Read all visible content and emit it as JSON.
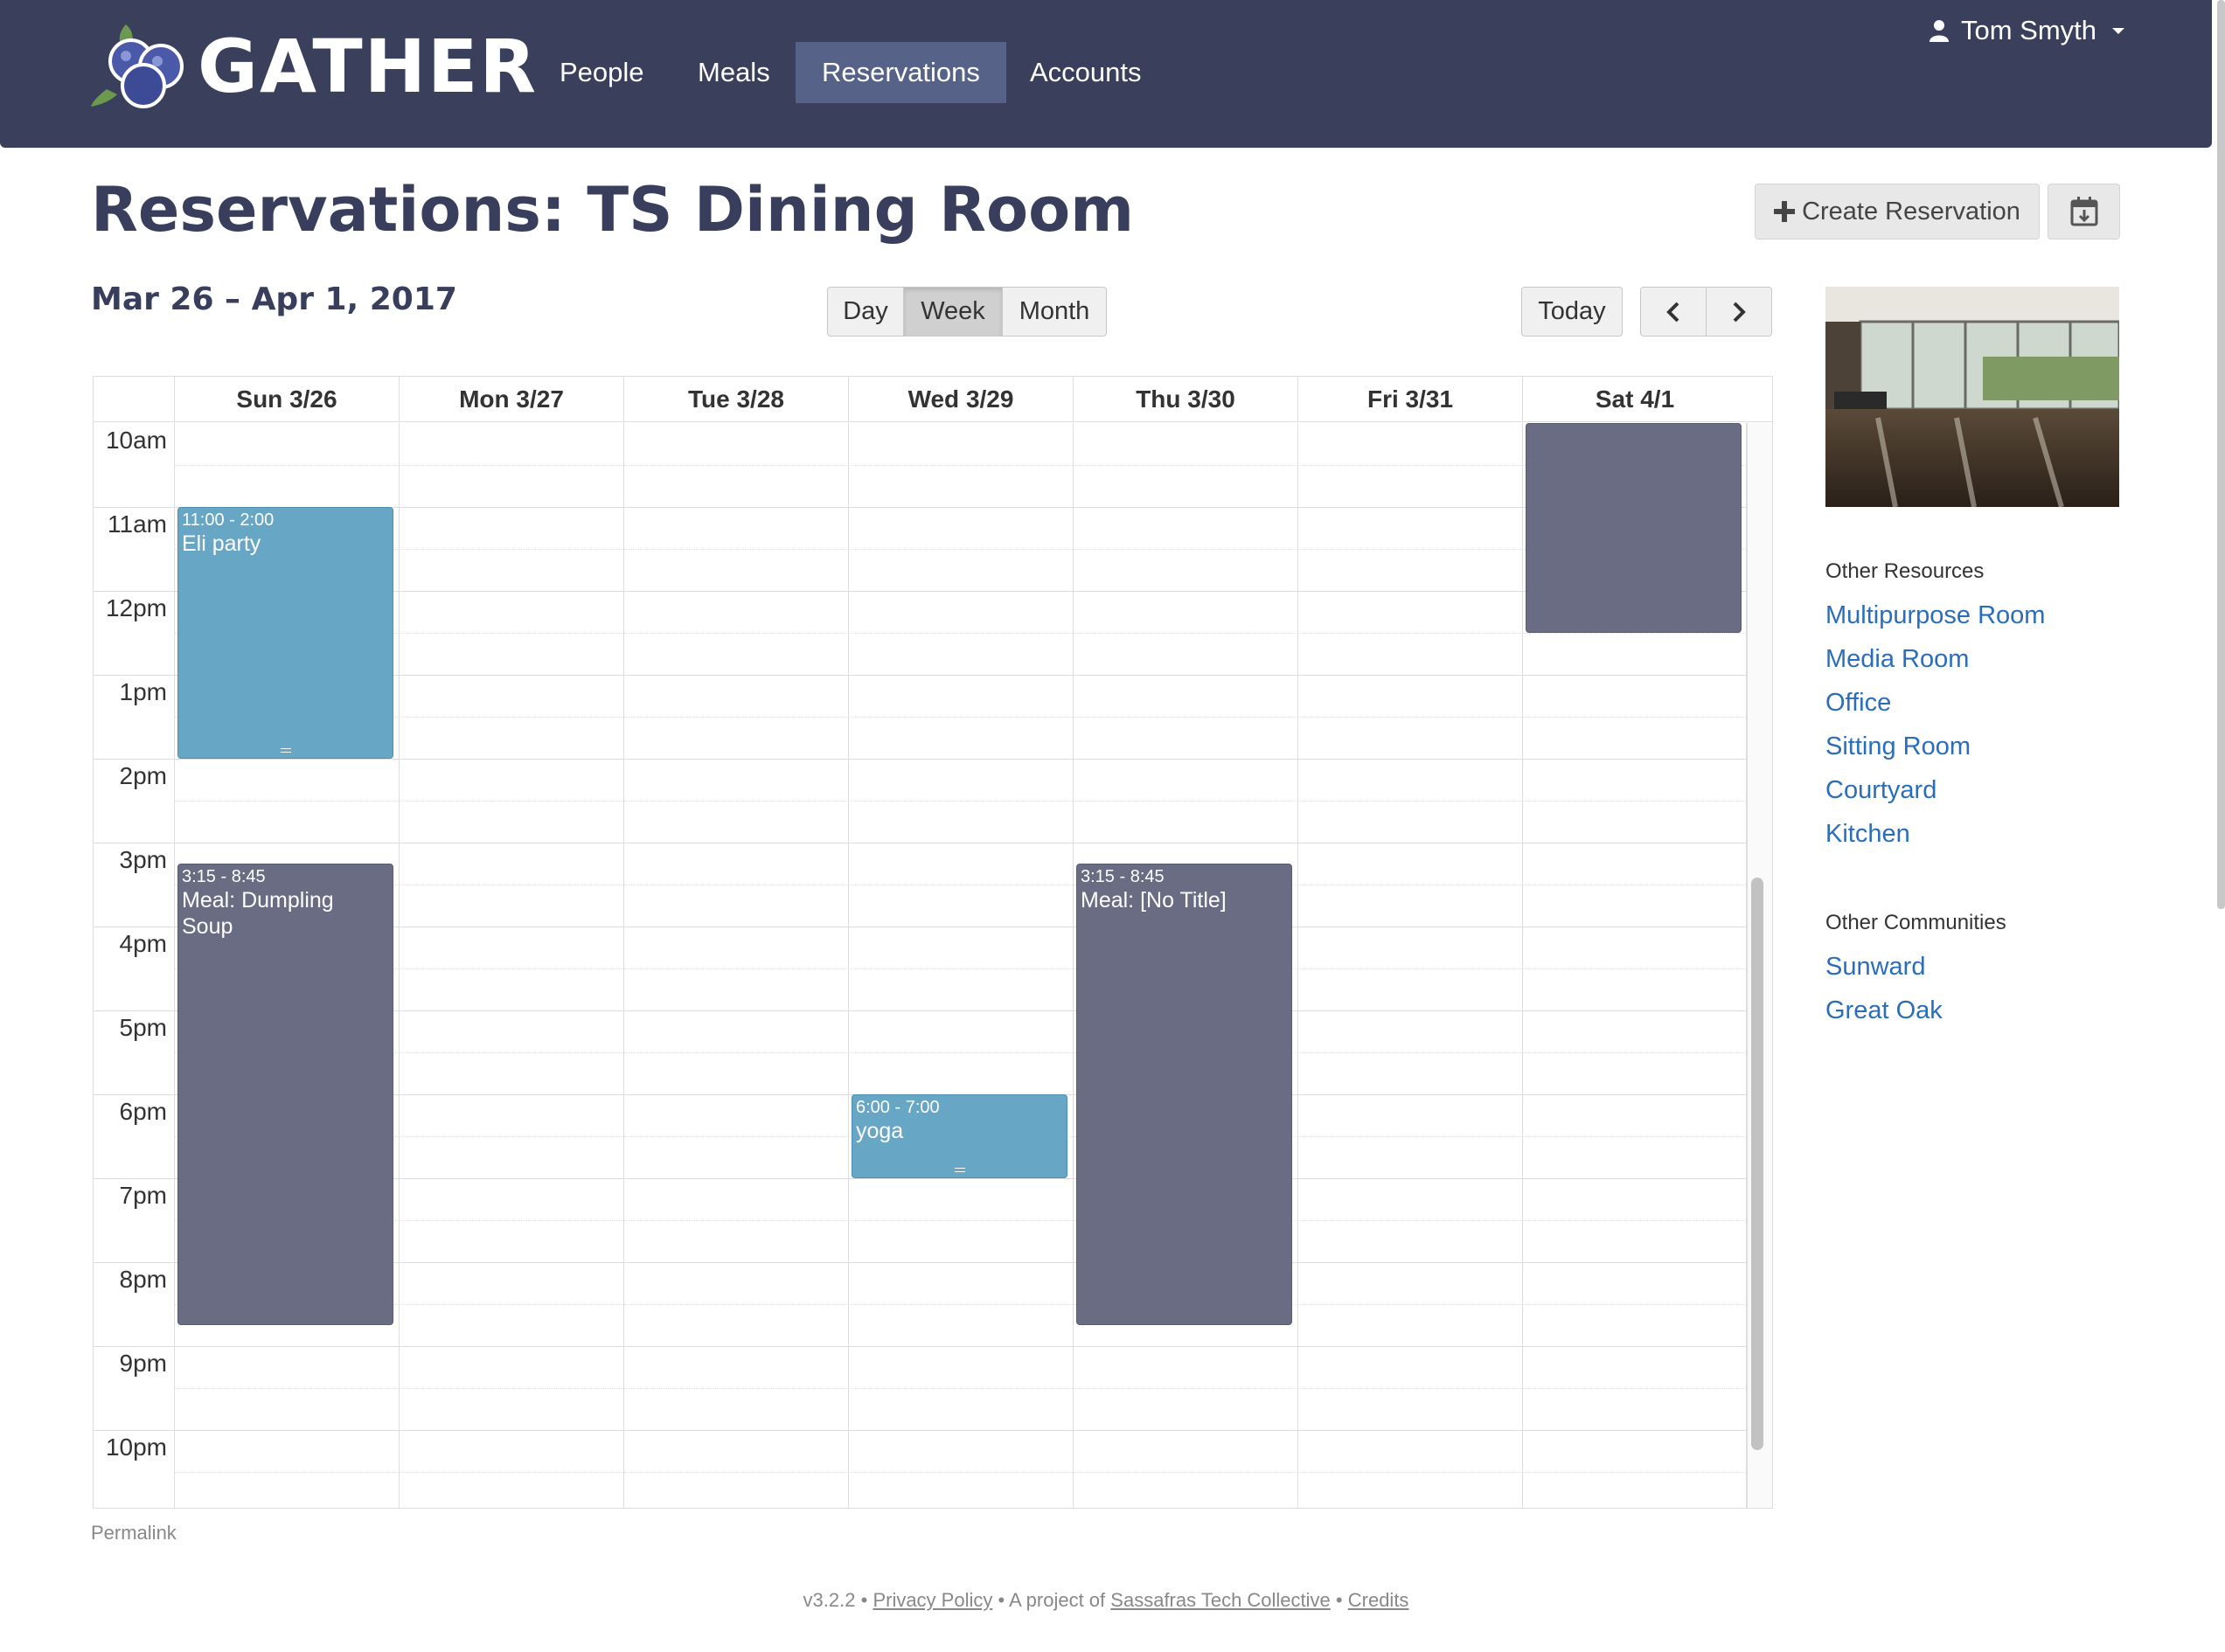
{
  "colors": {
    "navbar": "#3a3f5c",
    "nav_active": "#566287",
    "title": "#393e5c",
    "link": "#2a6ebb",
    "event_editable": "#68a6c6",
    "event_other": "#6a6c84"
  },
  "header": {
    "logo_icon": "blueberries-logo",
    "brand": "GATHER",
    "nav": [
      {
        "label": "People"
      },
      {
        "label": "Meals"
      },
      {
        "label": "Reservations",
        "active": true
      },
      {
        "label": "Accounts"
      }
    ],
    "user_icon": "user-icon",
    "user_name": "Tom Smyth"
  },
  "page": {
    "title": "Reservations: TS Dining Room",
    "create_label": "Create Reservation",
    "create_icon": "plus-icon",
    "export_icon": "calendar-download-icon",
    "date_range": "Mar 26 – Apr 1, 2017"
  },
  "toolbar": {
    "views": [
      {
        "label": "Day"
      },
      {
        "label": "Week",
        "active": true
      },
      {
        "label": "Month"
      }
    ],
    "today_label": "Today",
    "prev_icon": "chevron-left-icon",
    "next_icon": "chevron-right-icon"
  },
  "calendar": {
    "days": [
      "Sun 3/26",
      "Mon 3/27",
      "Tue 3/28",
      "Wed 3/29",
      "Thu 3/30",
      "Fri 3/31",
      "Sat 4/1"
    ],
    "hours": [
      "10am",
      "11am",
      "12pm",
      "1pm",
      "2pm",
      "3pm",
      "4pm",
      "5pm",
      "6pm",
      "7pm",
      "8pm",
      "9pm",
      "10pm"
    ],
    "events": [
      {
        "day": 0,
        "start": "11:00",
        "end": "14:00",
        "time": "11:00 - 2:00",
        "title": "Eli party",
        "kind": "editable"
      },
      {
        "day": 0,
        "start": "15:15",
        "end": "20:45",
        "time": "3:15 - 8:45",
        "title": "Meal: Dumpling Soup",
        "kind": "other"
      },
      {
        "day": 3,
        "start": "18:00",
        "end": "19:00",
        "time": "6:00 - 7:00",
        "title": "yoga",
        "kind": "editable"
      },
      {
        "day": 4,
        "start": "15:15",
        "end": "20:45",
        "time": "3:15 - 8:45",
        "title": "Meal: [No Title]",
        "kind": "other"
      },
      {
        "day": 6,
        "start": "09:00",
        "end": "12:30",
        "time": "",
        "title": "",
        "kind": "other"
      }
    ],
    "permalink": "Permalink"
  },
  "sidebar": {
    "resources_heading": "Other Resources",
    "resources": [
      "Multipurpose Room",
      "Media Room",
      "Office",
      "Sitting Room",
      "Courtyard",
      "Kitchen"
    ],
    "communities_heading": "Other Communities",
    "communities": [
      "Sunward",
      "Great Oak"
    ]
  },
  "footer": {
    "version": "v3.2.2",
    "sep": "•",
    "privacy": "Privacy Policy",
    "project_of": "A project of",
    "collective": "Sassafras Tech Collective",
    "credits": "Credits"
  }
}
